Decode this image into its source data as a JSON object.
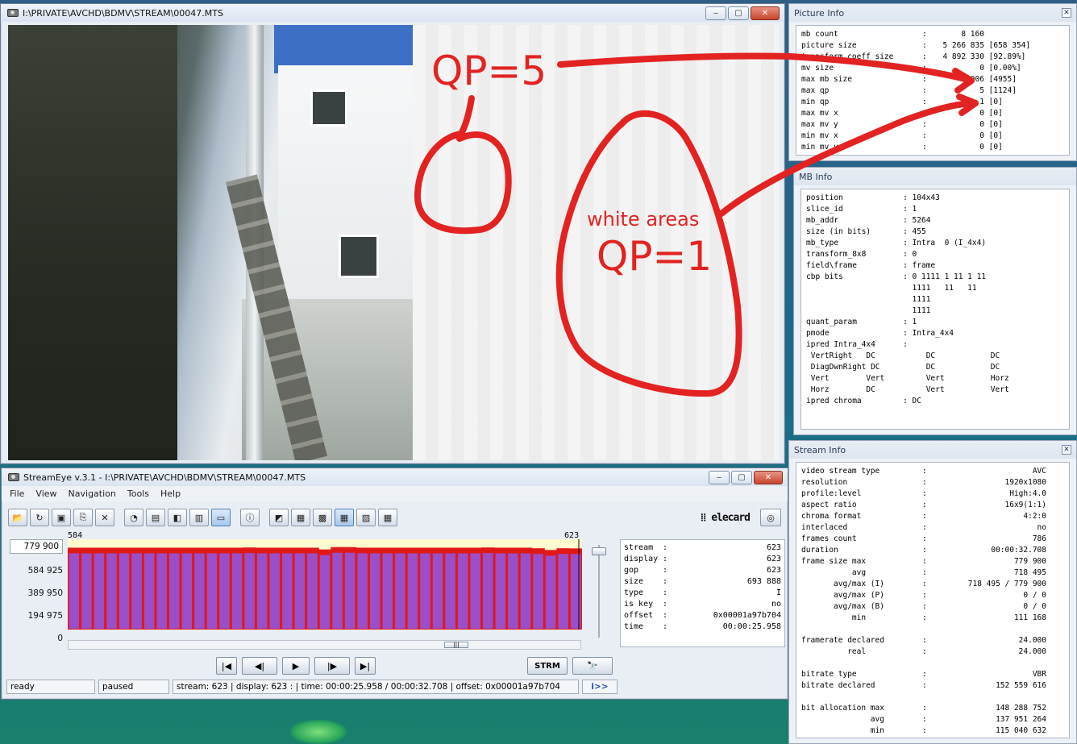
{
  "viewer": {
    "title": "I:\\PRIVATE\\AVCHD\\BDMV\\STREAM\\00047.MTS",
    "minimize": "‒",
    "maximize": "▢",
    "close": "✕"
  },
  "annotations": {
    "qp5": "QP=5",
    "white_areas": "white areas",
    "qp1": "QP=1",
    "color": "#e32222"
  },
  "picture_info": {
    "title": "Picture Info",
    "close": "✕",
    "rows": [
      {
        "k": "mb count",
        "v": "      8 160"
      },
      {
        "k": "picture size",
        "v": "  5 266 835 [658 354]"
      },
      {
        "k": "transform coeff size",
        "v": "  4 892 330 [92.89%]"
      },
      {
        "k": "mv size",
        "v": "          0 [0.00%]"
      },
      {
        "k": "max mb size",
        "v": "        906 [4955]"
      },
      {
        "k": "max qp",
        "v": "          5 [1124]"
      },
      {
        "k": "min qp",
        "v": "          1 [0]"
      },
      {
        "k": "max mv x",
        "v": "          0 [0]"
      },
      {
        "k": "max mv y",
        "v": "          0 [0]"
      },
      {
        "k": "min mv x",
        "v": "          0 [0]"
      },
      {
        "k": "min mv y",
        "v": "          0 [0]"
      }
    ]
  },
  "mb_info": {
    "title": "MB Info",
    "lines": [
      "position             : 104x43",
      "slice_id             : 1",
      "mb_addr              : 5264",
      "size (in bits)       : 455",
      "mb_type              : Intra  0 (I_4x4)",
      "transform_8x8        : 0",
      "field\\frame          : frame",
      "cbp bits             : 0 1111 1 11 1 11",
      "                       1111   11   11",
      "                       1111",
      "                       1111",
      "quant_param          : 1",
      "pmode                : Intra_4x4",
      "ipred Intra_4x4      :",
      " VertRight   DC           DC            DC",
      " DiagDwnRight DC          DC            DC",
      " Vert        Vert         Vert          Horz",
      " Horz        DC           Vert          Vert",
      "ipred chroma         : DC"
    ]
  },
  "stream_info": {
    "title": "Stream Info",
    "close": "✕",
    "rows": [
      {
        "k": "video stream type",
        "v": "AVC"
      },
      {
        "k": "resolution",
        "v": "1920x1080"
      },
      {
        "k": "profile:level",
        "v": "High:4.0"
      },
      {
        "k": "aspect ratio",
        "v": "16x9(1:1)"
      },
      {
        "k": "chroma format",
        "v": "4:2:0"
      },
      {
        "k": "interlaced",
        "v": "no"
      },
      {
        "k": "frames count",
        "v": "786"
      },
      {
        "k": "duration",
        "v": "00:00:32.708"
      },
      {
        "k": "frame size max",
        "v": "779 900"
      },
      {
        "k": "           avg",
        "v": "718 495"
      },
      {
        "k": "       avg/max (I)",
        "v": "718 495 / 779 900"
      },
      {
        "k": "       avg/max (P)",
        "v": "0 / 0"
      },
      {
        "k": "       avg/max (B)",
        "v": "0 / 0"
      },
      {
        "k": "           min",
        "v": "111 168"
      },
      {
        "k": "",
        "v": ""
      },
      {
        "k": "framerate declared",
        "v": "24.000"
      },
      {
        "k": "          real",
        "v": "24.000"
      },
      {
        "k": "",
        "v": ""
      },
      {
        "k": "bitrate type",
        "v": "VBR"
      },
      {
        "k": "bitrate declared",
        "v": "152 559 616"
      },
      {
        "k": "",
        "v": ""
      },
      {
        "k": "bit allocation max",
        "v": "148 288 752"
      },
      {
        "k": "               avg",
        "v": "137 951 264"
      },
      {
        "k": "               min",
        "v": "115 040 632"
      }
    ]
  },
  "streameye": {
    "title": "StreamEye v.3.1 - I:\\PRIVATE\\AVCHD\\BDMV\\STREAM\\00047.MTS",
    "menu": [
      "File",
      "View",
      "Navigation",
      "Tools",
      "Help"
    ],
    "logo": "⁞⁞ elecard",
    "y_box": "779 900",
    "y_labels": [
      "584 925",
      "389 950",
      "194 975",
      "0"
    ],
    "range_start": "584",
    "range_end": "623",
    "info": [
      {
        "k": "stream",
        "v": "623"
      },
      {
        "k": "display",
        "v": "623"
      },
      {
        "k": "gop",
        "v": "623"
      },
      {
        "k": "size",
        "v": "693 888"
      },
      {
        "k": "type",
        "v": "I"
      },
      {
        "k": "is key",
        "v": "no"
      },
      {
        "k": "offset",
        "v": "0x00001a97b704"
      },
      {
        "k": "time",
        "v": "00:00:25.958"
      }
    ],
    "nav": {
      "first": "|◀",
      "prev": "◀|",
      "play": "▶",
      "next": "|▶",
      "last": "▶|",
      "strm": "STRM",
      "find": "🔭"
    },
    "scroll_thumb": "|||",
    "status": {
      "ready": "ready",
      "paused": "paused",
      "position": "stream: 623 | display: 623 : | time: 00:00:25.958 / 00:00:32.708 | offset: 0x00001a97b704",
      "go": "i>>"
    }
  },
  "chart_data": {
    "type": "bar",
    "ylim": [
      0,
      779900
    ],
    "y_ticks": [
      0,
      194975,
      389950,
      584925,
      779900
    ],
    "x_range": [
      584,
      623
    ],
    "values": [
      700000,
      700000,
      700000,
      700000,
      700000,
      700000,
      700000,
      700000,
      700000,
      700000,
      700000,
      700000,
      700000,
      700000,
      702000,
      700000,
      700000,
      700000,
      700000,
      700000,
      685000,
      705000,
      705000,
      700000,
      700000,
      700000,
      700000,
      700000,
      700000,
      700000,
      700000,
      700000,
      700000,
      702000,
      700000,
      700000,
      700000,
      695000,
      680000,
      695000,
      693888
    ],
    "colors": {
      "fill": "#9a4fc9",
      "cap": "#e01818",
      "bg": "#fffbd0"
    }
  }
}
